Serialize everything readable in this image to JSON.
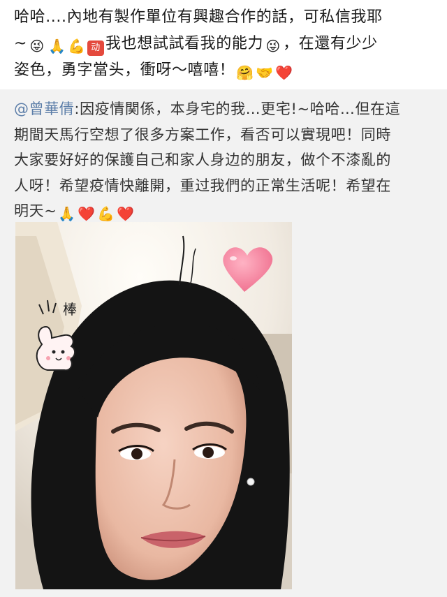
{
  "post": {
    "line1": "哈哈....內地有製作單位有興趣合作的話，可私信我耶",
    "line2_prefix": "~",
    "line2_text": "我也想試試看我的能力",
    "line2_suffix": "，在還有少少",
    "line3_text": "姿色，勇字當头，衝呀～嘻嘻！",
    "badge_text": "动"
  },
  "repost": {
    "mention": "@曾華倩",
    "line1": ":因疫情関係，本身宅的我…更宅!~哈哈…但在這",
    "line2": "期間天馬行空想了很多方案工作，看否可以實現吧！同時",
    "line3": "大家要好好的保護自己和家人身边的朋友，做个不漆亂的",
    "line4": "人呀！希望疫情快離開，重过我們的正常生活呢！希望在",
    "line5": "明天~"
  },
  "photo": {
    "sticker_text": "棒"
  },
  "colors": {
    "mention": "#5b7da8",
    "repost_bg": "#f2f2f2",
    "badge": "#e4493d",
    "heart": "#e0304a"
  }
}
